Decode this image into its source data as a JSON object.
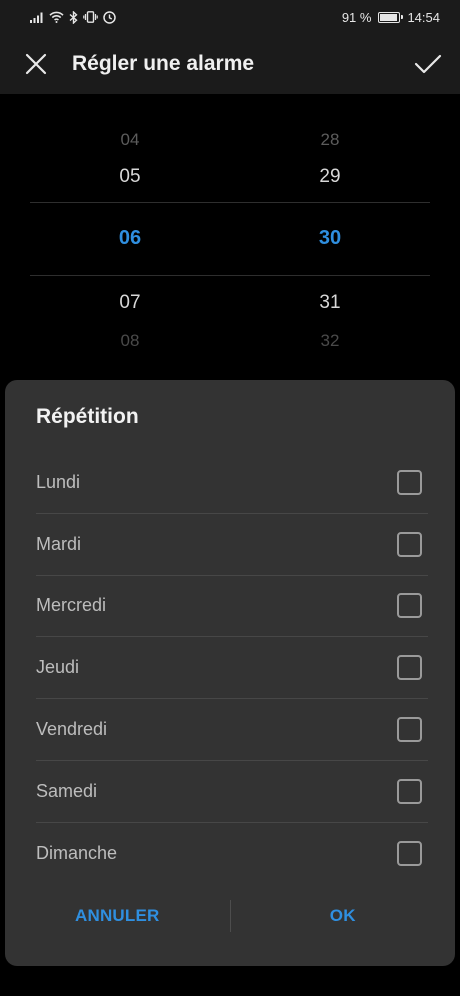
{
  "status_bar": {
    "battery_percent": "91 %",
    "battery_level": 0.91,
    "time": "14:54",
    "icons": [
      "signal-icon",
      "wifi-icon",
      "bluetooth-icon",
      "vibrate-icon",
      "alarm-icon",
      "battery-icon"
    ]
  },
  "app_bar": {
    "title": "Régler une alarme",
    "close_icon": "close-icon",
    "confirm_icon": "check-icon"
  },
  "time_picker": {
    "hours": {
      "far_top": "04",
      "near_top": "05",
      "selected": "06",
      "near_bottom": "07",
      "far_bottom": "08"
    },
    "minutes": {
      "far_top": "28",
      "near_top": "29",
      "selected": "30",
      "near_bottom": "31",
      "far_bottom": "32"
    },
    "selected_color": "#2f8fe0"
  },
  "dialog": {
    "title": "Répétition",
    "days": [
      {
        "label": "Lundi",
        "checked": false
      },
      {
        "label": "Mardi",
        "checked": false
      },
      {
        "label": "Mercredi",
        "checked": false
      },
      {
        "label": "Jeudi",
        "checked": false
      },
      {
        "label": "Vendredi",
        "checked": false
      },
      {
        "label": "Samedi",
        "checked": false
      },
      {
        "label": "Dimanche",
        "checked": false
      }
    ],
    "cancel_label": "ANNULER",
    "ok_label": "OK",
    "accent_color": "#2f8fe0"
  }
}
